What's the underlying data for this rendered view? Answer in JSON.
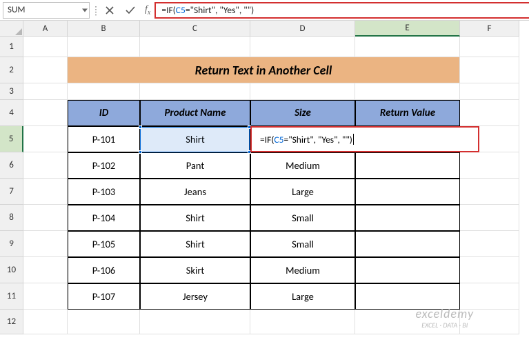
{
  "namebox": "SUM",
  "formula_pre": "=IF(",
  "formula_ref": "C5",
  "formula_post": "=\"Shirt\", \"Yes\", \"\")",
  "cols": {
    "A": "A",
    "B": "B",
    "C": "C",
    "D": "D",
    "E": "E",
    "F": "F"
  },
  "rows": {
    "r1": "1",
    "r2": "2",
    "r3": "3",
    "r4": "4",
    "r5": "5",
    "r6": "6",
    "r7": "7",
    "r8": "8",
    "r9": "9",
    "r10": "10",
    "r11": "11",
    "r12": "12"
  },
  "title": "Return Text in Another Cell",
  "head": {
    "id": "ID",
    "pname": "Product Name",
    "size": "Size",
    "rv": "Return Value"
  },
  "data": {
    "r5": {
      "id": "P-101",
      "pname": "Shirt",
      "size": ""
    },
    "r6": {
      "id": "P-102",
      "pname": "Pant",
      "size": "Medium"
    },
    "r7": {
      "id": "P-103",
      "pname": "Jeans",
      "size": "Large"
    },
    "r8": {
      "id": "P-104",
      "pname": "Shirt",
      "size": "Small"
    },
    "r9": {
      "id": "P-105",
      "pname": "Shirt",
      "size": "Small"
    },
    "r10": {
      "id": "P-106",
      "pname": "Skirt",
      "size": "Medium"
    },
    "r11": {
      "id": "P-107",
      "pname": "Jersey",
      "size": "Large"
    }
  },
  "wm1": "exceldemy",
  "wm2": "EXCEL · DATA · BI"
}
